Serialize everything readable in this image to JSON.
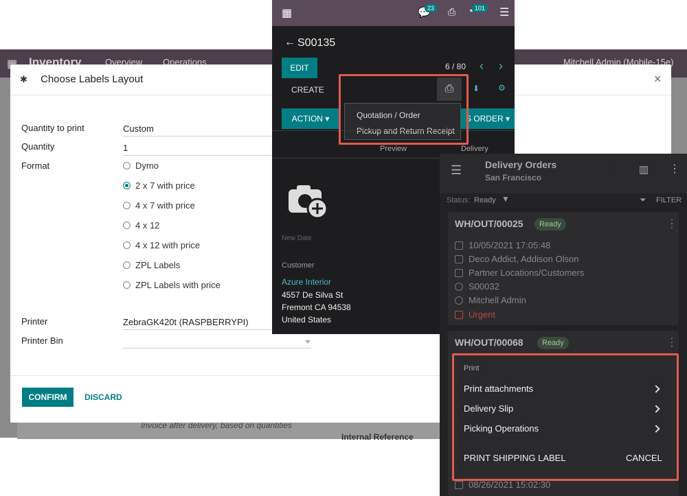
{
  "background": {
    "app_name": "Inventory",
    "nav": [
      "Overview",
      "Operations"
    ],
    "user": "Mitchell Admin (Mobile-15e)",
    "note": "Invoice after delivery, based on quantities",
    "field": "Internal Reference"
  },
  "dialog": {
    "title": "Choose Labels Layout",
    "quantity_to_print_label": "Quantity to print",
    "quantity_to_print_value": "Custom",
    "quantity_label": "Quantity",
    "quantity_value": "1",
    "format_label": "Format",
    "formats": [
      {
        "label": "Dymo",
        "selected": false
      },
      {
        "label": "2 x 7 with price",
        "selected": true
      },
      {
        "label": "4 x 7 with price",
        "selected": false
      },
      {
        "label": "4 x 12",
        "selected": false
      },
      {
        "label": "4 x 12 with price",
        "selected": false
      },
      {
        "label": "ZPL Labels",
        "selected": false
      },
      {
        "label": "ZPL Labels with price",
        "selected": false
      }
    ],
    "printer_label": "Printer",
    "printer_value": "ZebraGK420t (RASPBERRYPI)",
    "printer_bin_label": "Printer Bin",
    "printer_bin_value": "",
    "confirm": "CONFIRM",
    "discard": "DISCARD",
    "close": "×"
  },
  "sale_order": {
    "badge_messages": "23",
    "badge_activities": "101",
    "title": "S00135",
    "edit": "EDIT",
    "create": "CREATE",
    "pager": "6 / 80",
    "action": "ACTION",
    "order": "S ORDER",
    "print_menu": [
      "Quotation / Order",
      "Pickup and Return Receipt"
    ],
    "preview": "Preview",
    "delivery": "Delivery",
    "new_date": "New Date",
    "customer_label": "Customer",
    "customer_name": "Azure Interior",
    "address": [
      "4557 De Silva St",
      "Fremont CA 94538",
      "United States"
    ]
  },
  "delivery": {
    "title": "Delivery Orders",
    "subtitle": "San Francisco",
    "status_label": "Status:",
    "status_value": "Ready",
    "filter": "FILTER",
    "card1": {
      "ref": "WH/OUT/00025",
      "badge": "Ready",
      "rows": [
        "10/05/2021 17:05:48",
        "Deco Addict, Addison Olson",
        "Partner Locations/Customers",
        "S00032",
        "Mitchell Admin",
        "Urgent"
      ]
    },
    "card2": {
      "ref": "WH/OUT/00068",
      "badge": "Ready",
      "date": "08/26/2021 15:02:30"
    },
    "sheet": {
      "header": "Print",
      "items": [
        "Print attachments",
        "Delivery Slip",
        "Picking Operations"
      ],
      "ship_label": "PRINT SHIPPING LABEL",
      "cancel": "CANCEL"
    }
  },
  "colors": {
    "accent": "#017e84",
    "highlight": "#e05a4f",
    "navbar": "#5b4a5a"
  }
}
